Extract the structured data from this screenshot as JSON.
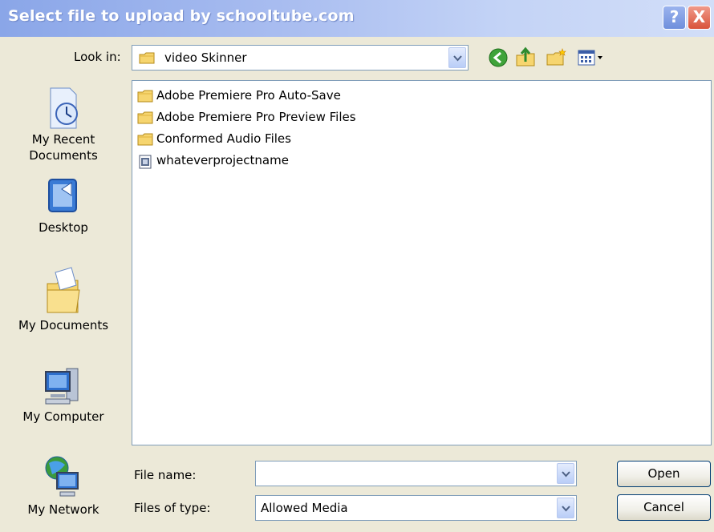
{
  "window": {
    "title": "Select file to upload by schooltube.com",
    "help_label": "?",
    "close_label": "X"
  },
  "look_in": {
    "label": "Look in:",
    "value": "video Skinner"
  },
  "toolbar": {
    "icons": [
      "back-icon",
      "up-folder-icon",
      "new-folder-icon",
      "views-menu-icon"
    ]
  },
  "places": [
    {
      "label": "My Recent Documents",
      "line1": "My Recent",
      "line2": "Documents",
      "icon": "recent-documents-icon"
    },
    {
      "label": "Desktop",
      "icon": "desktop-icon"
    },
    {
      "label": "My Documents",
      "icon": "my-documents-icon"
    },
    {
      "label": "My Computer",
      "icon": "my-computer-icon"
    },
    {
      "label": "My Network",
      "icon": "my-network-icon"
    }
  ],
  "files": [
    {
      "name": "Adobe Premiere Pro Auto-Save",
      "type": "folder"
    },
    {
      "name": "Adobe Premiere Pro Preview Files",
      "type": "folder"
    },
    {
      "name": "Conformed Audio Files",
      "type": "folder"
    },
    {
      "name": "whateverprojectname",
      "type": "file"
    }
  ],
  "file_name": {
    "label": "File name:",
    "value": ""
  },
  "file_type": {
    "label": "Files of type:",
    "value": "Allowed Media"
  },
  "buttons": {
    "open": "Open",
    "cancel": "Cancel"
  },
  "colors": {
    "titlebar": "#a9bdf0",
    "dialog_bg": "#ece9d8",
    "close_button": "#d9533a",
    "folder": "#f6d56f"
  }
}
